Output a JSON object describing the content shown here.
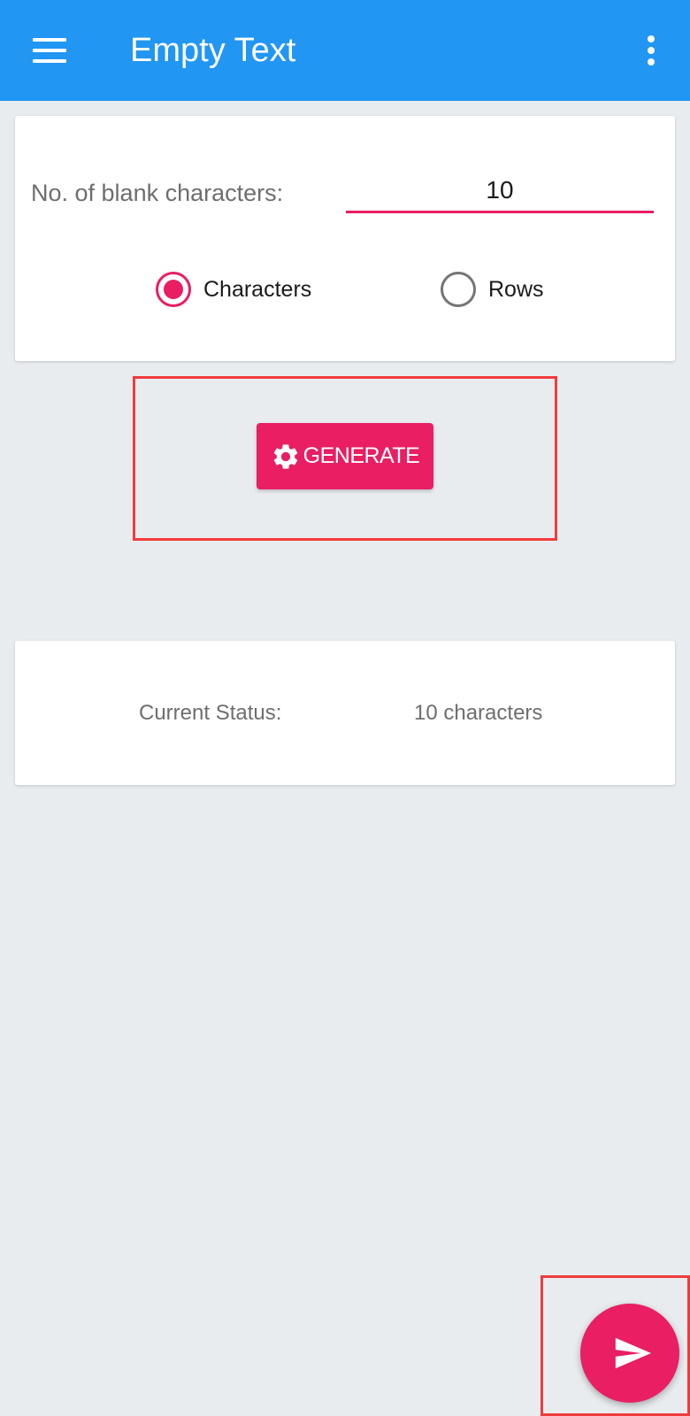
{
  "appbar": {
    "title": "Empty Text",
    "menu_icon": "hamburger-menu-icon",
    "overflow_icon": "more-vertical-icon",
    "color": "#2196f3"
  },
  "settings": {
    "field_label": "No. of blank characters:",
    "field_value": "10",
    "radio_options": [
      {
        "label": "Characters",
        "selected": true
      },
      {
        "label": "Rows",
        "selected": false
      }
    ],
    "accent_color": "#e91e63"
  },
  "generate_button": {
    "label": "GENERATE",
    "icon": "gear-icon"
  },
  "status": {
    "label": "Current Status:",
    "value": "10 characters"
  },
  "fab": {
    "icon": "send-icon"
  },
  "highlight_color": "#f03c3c"
}
